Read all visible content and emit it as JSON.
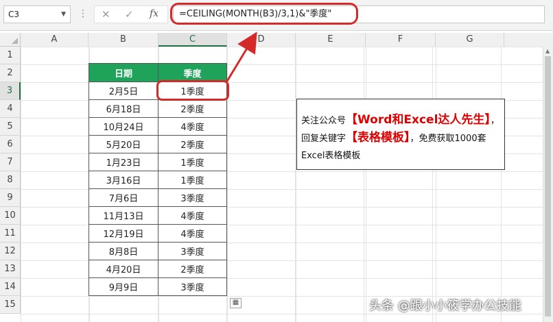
{
  "formula_bar": {
    "name_box": "C3",
    "cancel_icon": "✕",
    "enter_icon": "✓",
    "fx_label": "fx",
    "formula": "=CEILING(MONTH(B3)/3,1)&\"季度\""
  },
  "columns": [
    "A",
    "B",
    "C",
    "D",
    "E",
    "F",
    "G"
  ],
  "rows": [
    "1",
    "2",
    "3",
    "4",
    "5",
    "6",
    "7",
    "8",
    "9",
    "10",
    "11",
    "12",
    "13",
    "14",
    "15"
  ],
  "table": {
    "headers": [
      "日期",
      "季度"
    ],
    "rows": [
      [
        "2月5日",
        "1季度"
      ],
      [
        "6月18日",
        "2季度"
      ],
      [
        "10月24日",
        "4季度"
      ],
      [
        "5月20日",
        "2季度"
      ],
      [
        "1月23日",
        "1季度"
      ],
      [
        "3月16日",
        "1季度"
      ],
      [
        "7月6日",
        "3季度"
      ],
      [
        "11月13日",
        "4季度"
      ],
      [
        "12月19日",
        "4季度"
      ],
      [
        "8月8日",
        "3季度"
      ],
      [
        "4月20日",
        "2季度"
      ],
      [
        "9月9日",
        "3季度"
      ]
    ]
  },
  "note": {
    "part1": "关注公众号",
    "highlight1": "【Word和Excel达人先生】",
    "part2": "，回复关键字",
    "highlight2": "【表格模板】",
    "part3": "，免费获取1000套Excel表格模板"
  },
  "watermark": "头条 @跟小小筱学办公技能",
  "accent_colors": {
    "header_green": "#1fa25a",
    "annotation_red": "#d42a2a",
    "excel_green": "#217346"
  }
}
